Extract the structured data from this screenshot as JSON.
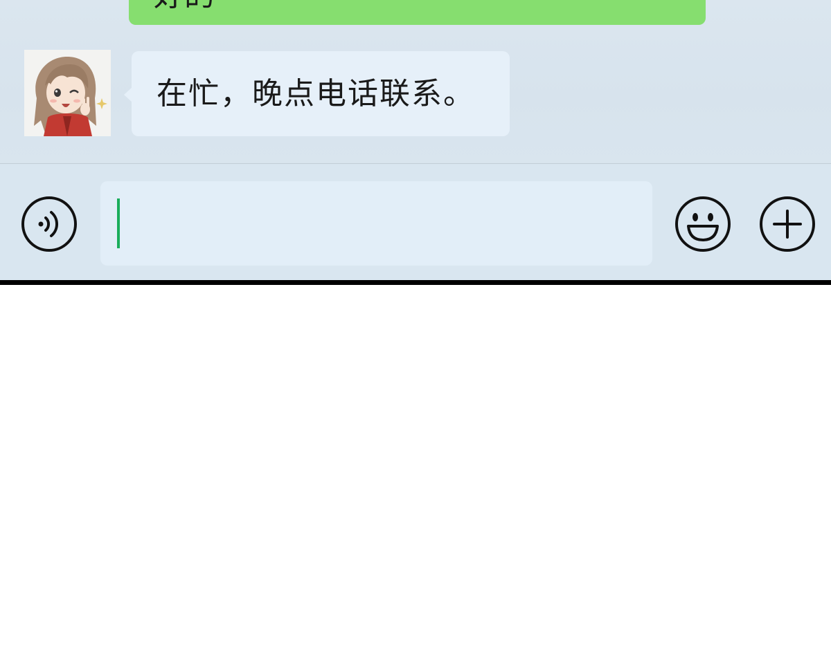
{
  "chat": {
    "sent_message": {
      "partial_text": "好的"
    },
    "received_message": {
      "text": "在忙，晚点电话联系。"
    }
  },
  "input_bar": {
    "voice_icon": "voice-icon",
    "emoji_icon": "emoji-icon",
    "plus_icon": "plus-icon",
    "text_value": "",
    "placeholder": ""
  },
  "colors": {
    "sent_bubble": "#86de6f",
    "received_bubble": "#e6f0f9",
    "chat_background": "#d9e5ee",
    "caret": "#1aad5b"
  }
}
